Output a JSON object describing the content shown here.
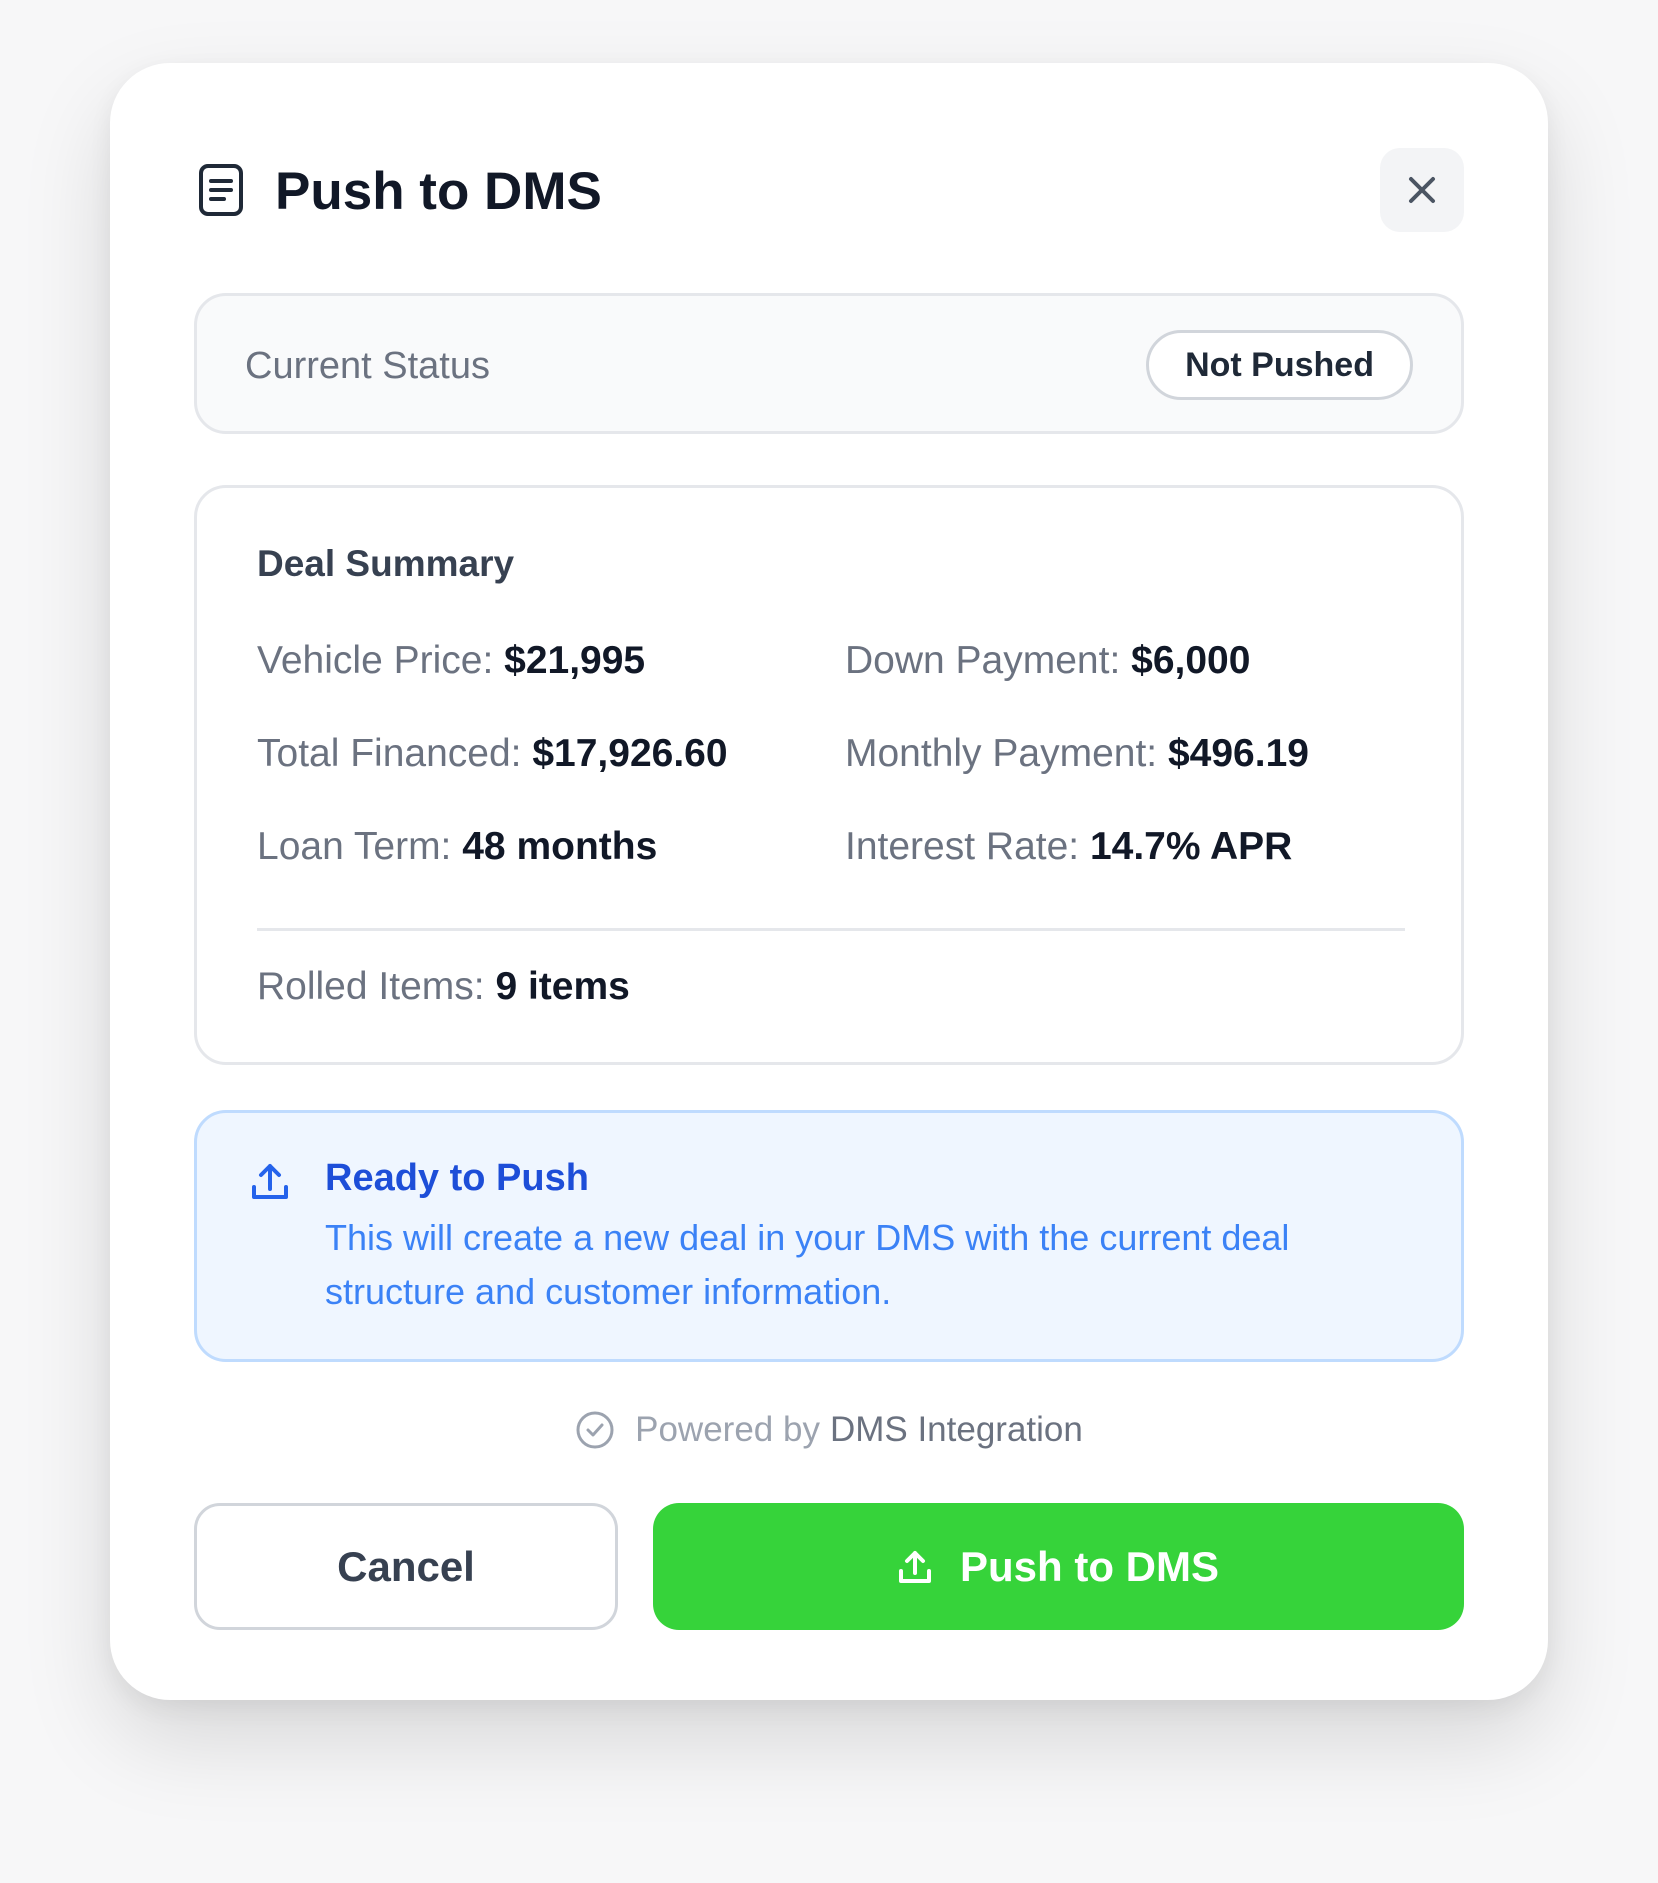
{
  "dialog": {
    "title": "Push to DMS",
    "icons": {
      "title": "document-icon",
      "close": "close-icon"
    }
  },
  "status": {
    "label": "Current Status",
    "badge": "Not Pushed"
  },
  "summary": {
    "title": "Deal Summary",
    "fields": [
      {
        "label": "Vehicle Price:",
        "value": "$21,995"
      },
      {
        "label": "Down Payment:",
        "value": "$6,000"
      },
      {
        "label": "Total Financed:",
        "value": "$17,926.60"
      },
      {
        "label": "Monthly Payment:",
        "value": "$496.19"
      },
      {
        "label": "Loan Term:",
        "value": "48 months"
      },
      {
        "label": "Interest Rate:",
        "value": "14.7% APR"
      }
    ],
    "rolled": {
      "label": "Rolled Items:",
      "value": "9 items"
    }
  },
  "info": {
    "icon": "upload-icon",
    "title": "Ready to Push",
    "text": "This will create a new deal in your DMS with the current deal structure and customer information."
  },
  "powered": {
    "icon": "check-circle-icon",
    "prefix": "Powered by",
    "brand": "DMS Integration"
  },
  "actions": {
    "cancel": "Cancel",
    "push": "Push to DMS",
    "push_icon": "upload-icon"
  },
  "colors": {
    "primary_green": "#36d33a",
    "info_blue": "#1d4ed8",
    "info_bg": "#eff6ff"
  }
}
